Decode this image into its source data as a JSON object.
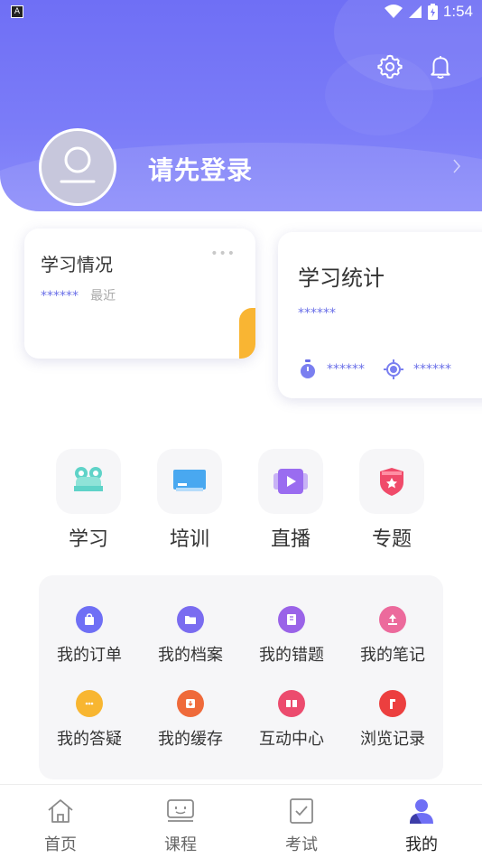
{
  "status_bar": {
    "time": "1:54",
    "badge": "A"
  },
  "profile": {
    "login_prompt": "请先登录"
  },
  "cards": {
    "study": {
      "title": "学习情况",
      "value": "******",
      "hint": "最近"
    },
    "stats": {
      "title": "学习统计",
      "value": "******",
      "time_value": "******",
      "progress_value": "******"
    }
  },
  "quick_actions": [
    {
      "label": "学习",
      "icon": "study-icon"
    },
    {
      "label": "培训",
      "icon": "training-icon"
    },
    {
      "label": "直播",
      "icon": "live-icon"
    },
    {
      "label": "专题",
      "icon": "topic-icon"
    }
  ],
  "my_items": [
    {
      "label": "我的订单",
      "icon": "bag-icon",
      "color": "#6f6ff5"
    },
    {
      "label": "我的档案",
      "icon": "folder-icon",
      "color": "#7a6cf0"
    },
    {
      "label": "我的错题",
      "icon": "book-icon",
      "color": "#9a63e8"
    },
    {
      "label": "我的笔记",
      "icon": "note-icon",
      "color": "#ec6a9c"
    },
    {
      "label": "我的答疑",
      "icon": "chat-icon",
      "color": "#f8b631"
    },
    {
      "label": "我的缓存",
      "icon": "download-icon",
      "color": "#ef6a3a"
    },
    {
      "label": "互动中心",
      "icon": "interact-icon",
      "color": "#ec4b6e"
    },
    {
      "label": "浏览记录",
      "icon": "history-icon",
      "color": "#ec3f3f"
    }
  ],
  "tabs": [
    {
      "label": "首页",
      "icon": "home-icon"
    },
    {
      "label": "课程",
      "icon": "course-icon"
    },
    {
      "label": "考试",
      "icon": "exam-icon"
    },
    {
      "label": "我的",
      "icon": "profile-icon",
      "active": true
    }
  ],
  "colors": {
    "accent": "#6f6ff5",
    "yellow": "#f9b533"
  }
}
